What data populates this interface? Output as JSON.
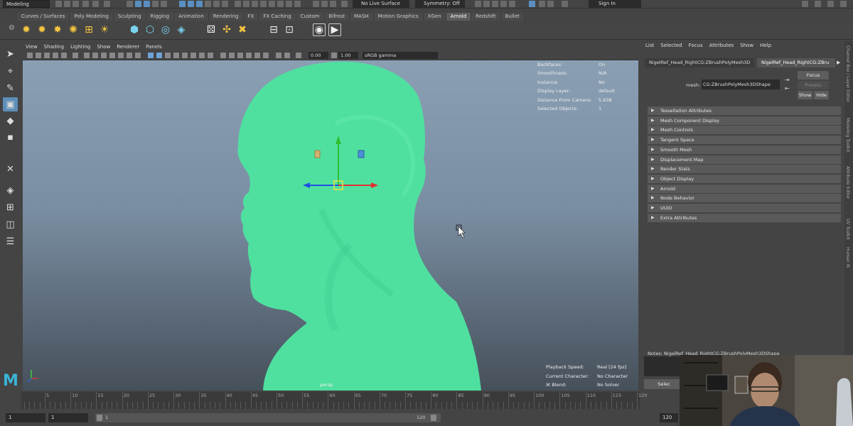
{
  "status_line": {
    "mode_menu": "Modeling",
    "live_surface": "No Live Surface",
    "symmetry": "Symmetry: Off",
    "sign_in": "Sign In"
  },
  "shelf_tabs": [
    {
      "label": "Curves / Surfaces"
    },
    {
      "label": "Poly Modeling"
    },
    {
      "label": "Sculpting"
    },
    {
      "label": "Rigging"
    },
    {
      "label": "Animation"
    },
    {
      "label": "Rendering"
    },
    {
      "label": "FX"
    },
    {
      "label": "FX Caching"
    },
    {
      "label": "Custom"
    },
    {
      "label": "Bifrost"
    },
    {
      "label": "MASH"
    },
    {
      "label": "Motion Graphics"
    },
    {
      "label": "XGen"
    },
    {
      "label": "Arnold"
    },
    {
      "label": "Redshift"
    },
    {
      "label": "Bullet"
    }
  ],
  "active_shelf_tab": "Arnold",
  "viewport": {
    "menu": [
      "View",
      "Shading",
      "Lighting",
      "Show",
      "Renderer",
      "Panels"
    ],
    "exposure": "0.00",
    "gamma": "1.00",
    "color_space": "sRGB gamma",
    "camera_label": "persp",
    "hud_top": [
      {
        "label": "Backfaces:",
        "value": "On"
      },
      {
        "label": "Smoothness:",
        "value": "N/A"
      },
      {
        "label": "Instance:",
        "value": "No"
      },
      {
        "label": "Display Layer:",
        "value": "default"
      },
      {
        "label": "Distance From Camera:",
        "value": "5.638"
      },
      {
        "label": "Selected Objects:",
        "value": "1"
      }
    ],
    "hud_bottom": [
      {
        "label": "Playback Speed:",
        "value": "Real [24 fps]"
      },
      {
        "label": "Current Character:",
        "value": "No Character"
      },
      {
        "label": "IK Blend:",
        "value": "No Solver"
      }
    ],
    "mesh_color": "#4fe0a0"
  },
  "attribute_editor": {
    "menu": [
      "List",
      "Selected",
      "Focus",
      "Attributes",
      "Show",
      "Help"
    ],
    "tabs": [
      "NigelRef_Head_RightCG:ZBrushPolyMesh3D",
      "NigelRef_Head_RightCG:ZBru"
    ],
    "mesh_label": "mesh:",
    "mesh_value": "CG:ZBrushPolyMesh3DShape",
    "focus": "Focus",
    "presets": "Presets",
    "show": "Show",
    "hide": "Hide",
    "sections": [
      "Tessellation Attributes",
      "Mesh Component Display",
      "Mesh Controls",
      "Tangent Space",
      "Smooth Mesh",
      "Displacement Map",
      "Render Stats",
      "Object Display",
      "Arnold",
      "Node Behavior",
      "UUID",
      "Extra Attributes"
    ],
    "notes": "Notes:  NigelRef_Head_RightCG:ZBrushPolyMesh3DShape",
    "select_button": "Selec"
  },
  "side_tabs": [
    "Channel Box / Layer Editor",
    "Modeling Toolkit",
    "Attribute Editor",
    "UV Toolkit",
    "Human IK"
  ],
  "time_slider": {
    "ticks": [
      "5",
      "10",
      "15",
      "20",
      "25",
      "30",
      "35",
      "40",
      "45",
      "50",
      "55",
      "60",
      "65",
      "70",
      "75",
      "80",
      "85",
      "90",
      "95",
      "100",
      "105",
      "110",
      "115",
      "120"
    ]
  },
  "range": {
    "start": "1",
    "playback_start": "1",
    "range_start": "1",
    "range_end": "120",
    "end": "120"
  }
}
